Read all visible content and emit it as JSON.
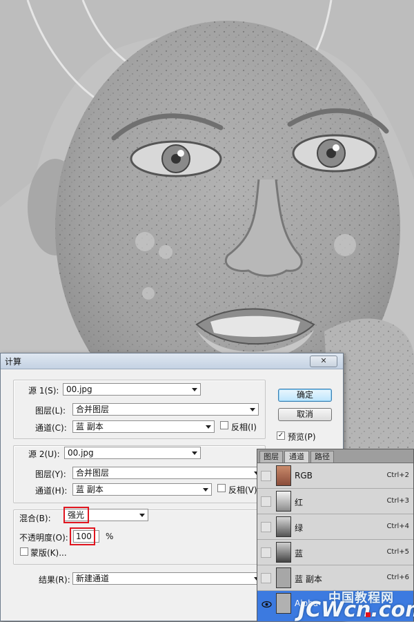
{
  "dialog": {
    "title": "计算",
    "close_glyph": "✕",
    "source1": {
      "label": "源 1(S):",
      "file": "00.jpg",
      "layer_label": "图层(L):",
      "layer_value": "合并图层",
      "channel_label": "通道(C):",
      "channel_value": "蓝 副本",
      "invert_label": "反相(I)",
      "invert_checked": false
    },
    "source2": {
      "label": "源 2(U):",
      "file": "00.jpg",
      "layer_label": "图层(Y):",
      "layer_value": "合并图层",
      "channel_label": "通道(H):",
      "channel_value": "蓝 副本",
      "invert_label": "反相(V)",
      "invert_checked": false
    },
    "blending_label": "混合(B):",
    "blending_value": "强光",
    "opacity_label": "不透明度(O):",
    "opacity_value": "100",
    "opacity_unit": "%",
    "mask_label": "蒙版(K)...",
    "mask_checked": false,
    "result_label": "结果(R):",
    "result_value": "新建通道",
    "ok_label": "确定",
    "cancel_label": "取消",
    "preview_label": "预览(P)",
    "preview_checked": true,
    "highlight_color": "#e0141e"
  },
  "panel": {
    "tabs": [
      "图层",
      "通道",
      "路径"
    ],
    "active_tab": "通道",
    "channels": [
      {
        "name": "RGB",
        "shortcut": "Ctrl+2",
        "visible": false,
        "selected": false
      },
      {
        "name": "红",
        "shortcut": "Ctrl+3",
        "visible": false,
        "selected": false
      },
      {
        "name": "绿",
        "shortcut": "Ctrl+4",
        "visible": false,
        "selected": false
      },
      {
        "name": "蓝",
        "shortcut": "Ctrl+5",
        "visible": false,
        "selected": false
      },
      {
        "name": "蓝 副本",
        "shortcut": "Ctrl+6",
        "visible": false,
        "selected": false
      },
      {
        "name": "Alpha",
        "shortcut": "",
        "visible": true,
        "selected": true
      }
    ],
    "selection_color": "#3c7ae0"
  },
  "watermark": {
    "line1": "中国教程网",
    "line2": "JCWcn.com"
  }
}
